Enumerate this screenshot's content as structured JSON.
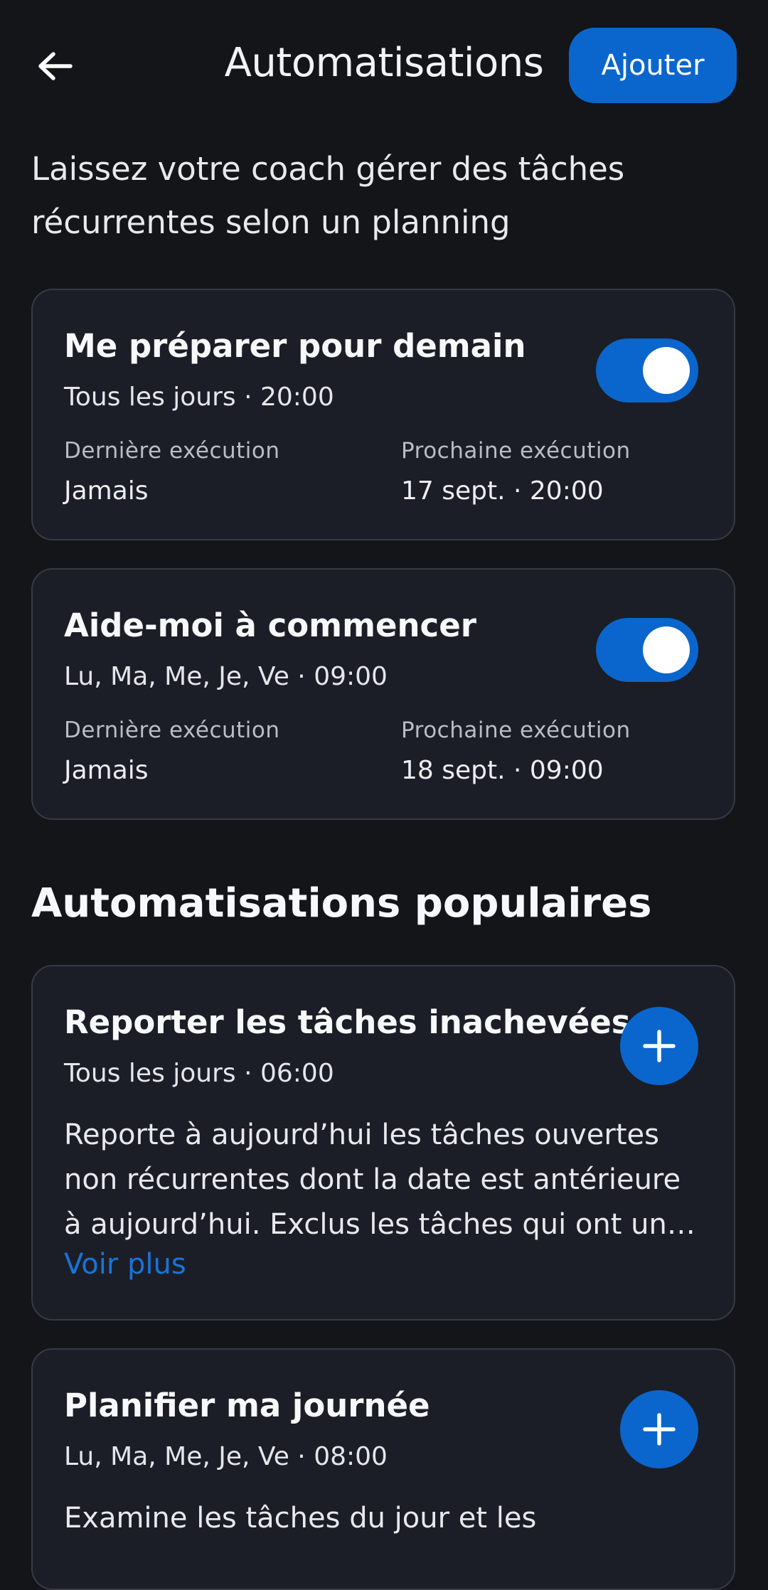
{
  "header": {
    "title": "Automatisations",
    "add_label": "Ajouter"
  },
  "subtitle": "Laissez votre coach gérer des tâches récurrentes selon un planning",
  "automations": [
    {
      "title": "Me préparer pour demain",
      "schedule": "Tous les jours · 20:00",
      "last_label": "Dernière exécution",
      "last_value": "Jamais",
      "next_label": "Prochaine exécution",
      "next_value": "17 sept. · 20:00",
      "enabled": true
    },
    {
      "title": "Aide-moi à commencer",
      "schedule": "Lu, Ma, Me, Je, Ve · 09:00",
      "last_label": "Dernière exécution",
      "last_value": "Jamais",
      "next_label": "Prochaine exécution",
      "next_value": "18 sept. · 09:00",
      "enabled": true
    }
  ],
  "popular": {
    "title": "Automatisations populaires",
    "items": [
      {
        "title": "Reporter les tâches inachevées",
        "schedule": "Tous les jours · 06:00",
        "description": "Reporte à aujourd’hui les tâches ouvertes non récurrentes dont la date est antérieure à aujourd’hui. Exclus les tâches qui ont une échéance.",
        "see_more": "Voir plus"
      },
      {
        "title": "Planifier ma journée",
        "schedule": "Lu, Ma, Me, Je, Ve · 08:00",
        "description": "Examine les tâches du jour et les"
      }
    ]
  },
  "colors": {
    "background": "#131519",
    "card": "#1b1e26",
    "accent": "#0a66cc",
    "link": "#1a73d9"
  },
  "icons": {
    "back": "arrow-left-icon",
    "add": "plus-icon"
  }
}
